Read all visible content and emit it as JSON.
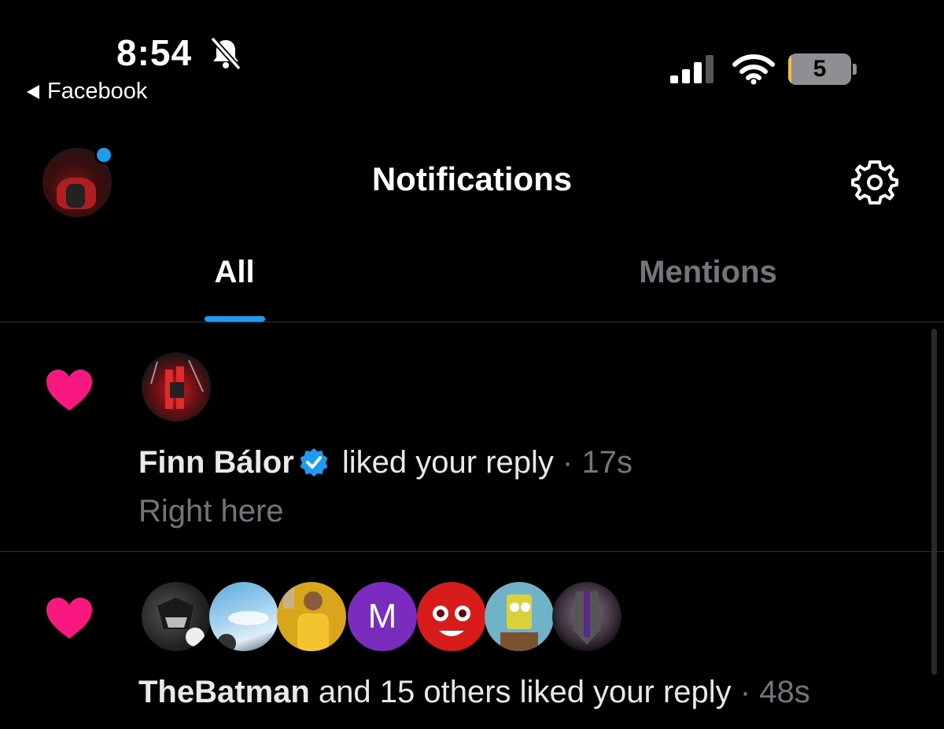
{
  "status_bar": {
    "time": "8:54",
    "back_app": "Facebook",
    "battery_level": "5",
    "battery_fraction": 0.05
  },
  "header": {
    "title": "Notifications"
  },
  "tabs": [
    {
      "label": "All",
      "selected": true
    },
    {
      "label": "Mentions",
      "selected": false
    }
  ],
  "colors": {
    "accent": "#1d9bf0",
    "like": "#f91880",
    "background": "#000000"
  },
  "notifications": [
    {
      "icon": "heart-icon",
      "actor": "Finn Bálor",
      "verified": true,
      "action": " liked your reply",
      "separator": " · ",
      "time": "17s",
      "snippet": "Right here"
    },
    {
      "icon": "heart-icon",
      "actor": "TheBatman",
      "action": " and 15 others liked your reply",
      "separator": " · ",
      "time": "48s",
      "avatar_letter": "M"
    }
  ]
}
